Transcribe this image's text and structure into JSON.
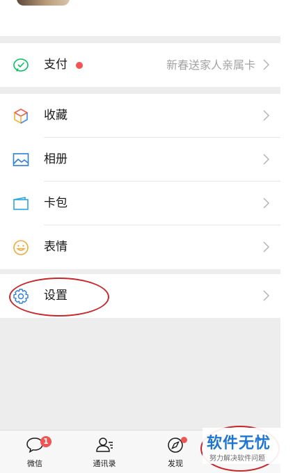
{
  "menu": {
    "payment": {
      "label": "支付",
      "note": "新春送家人亲属卡"
    },
    "favorites": {
      "label": "收藏"
    },
    "album": {
      "label": "相册"
    },
    "cards": {
      "label": "卡包"
    },
    "stickers": {
      "label": "表情"
    },
    "settings": {
      "label": "设置"
    }
  },
  "tabbar": {
    "chats": {
      "label": "微信",
      "badge": "1"
    },
    "contacts": {
      "label": "通讯录"
    },
    "discover": {
      "label": "发现"
    }
  },
  "watermark": {
    "title": "软件无忧",
    "subtitle": "努力解决软件问题"
  },
  "colors": {
    "accent_green": "#07c160",
    "badge_red": "#f05454",
    "annotation_red": "#c8262b",
    "watermark_blue": "#1f76d2"
  }
}
